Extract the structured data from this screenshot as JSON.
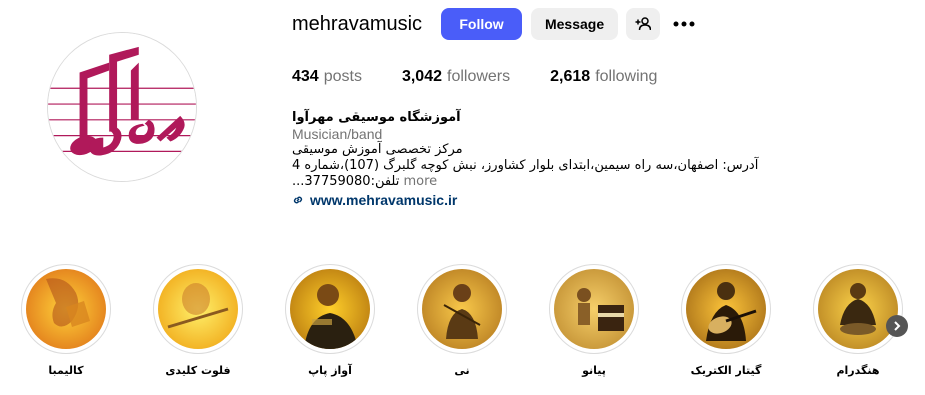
{
  "profile": {
    "username": "mehravamusic",
    "follow_label": "Follow",
    "message_label": "Message",
    "avatar_icon": "mehrava-logo",
    "accent": "#4a5df9",
    "logo_color": "#b0195a"
  },
  "stats": {
    "posts_count": "434",
    "posts_label": "posts",
    "followers_count": "3,042",
    "followers_label": "followers",
    "following_count": "2,618",
    "following_label": "following"
  },
  "bio": {
    "name": "آموزشگاه موسیقی مهرآوا",
    "category": "Musician/band",
    "line1": "مرکز تخصصی آموزش موسیقی",
    "line2": "آدرس: اصفهان،سه راه سیمین،ابتدای بلوار کشاورز، نبش کوچه گلبرگ (107)،شماره 4",
    "line3": "تلفن:37759080...",
    "more_label": "more",
    "link": "www.mehravamusic.ir"
  },
  "highlights": [
    {
      "label": "کالیمبا",
      "icon": "kalimba-photo"
    },
    {
      "label": "فلوت کلیدی",
      "icon": "flute-photo"
    },
    {
      "label": "آواز پاپ",
      "icon": "pop-vocal-photo"
    },
    {
      "label": "نی",
      "icon": "ney-photo"
    },
    {
      "label": "پیانو",
      "icon": "piano-photo"
    },
    {
      "label": "گیتار الکتریک",
      "icon": "electric-guitar-photo"
    },
    {
      "label": "هنگدرام",
      "icon": "handpan-photo"
    }
  ]
}
